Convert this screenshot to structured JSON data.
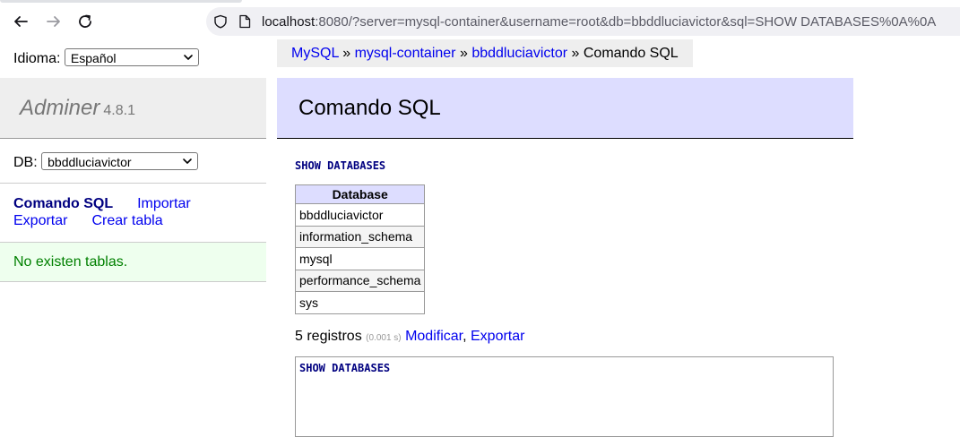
{
  "browser": {
    "url_host": "localhost",
    "url_rest": ":8080/?server=mysql-container&username=root&db=bbddluciavictor&sql=SHOW DATABASES%0A%0A",
    "back_icon": "arrow-left-icon",
    "forward_icon": "arrow-right-icon",
    "reload_icon": "reload-icon"
  },
  "sidebar": {
    "language_label": "Idioma:",
    "language_value": "Español",
    "app_name": "Adminer",
    "app_version": "4.8.1",
    "db_label": "DB:",
    "db_value": "bbddluciavictor",
    "links": {
      "sql_command": "Comando SQL",
      "import": "Importar",
      "export": "Exportar",
      "create_table": "Crear tabla"
    },
    "message": "No existen tablas."
  },
  "breadcrumb": {
    "items": [
      "MySQL",
      "mysql-container",
      "bbddluciavictor"
    ],
    "separator": "»",
    "current": "Comando SQL"
  },
  "main": {
    "heading": "Comando SQL",
    "query": "SHOW DATABASES",
    "result": {
      "column": "Database",
      "rows": [
        "bbddluciavictor",
        "information_schema",
        "mysql",
        "performance_schema",
        "sys"
      ]
    },
    "count_text": "5 registros",
    "time_text": "(0.001 s)",
    "modify_link": "Modificar",
    "export_link": "Exportar",
    "editor_text": "SHOW DATABASES"
  }
}
